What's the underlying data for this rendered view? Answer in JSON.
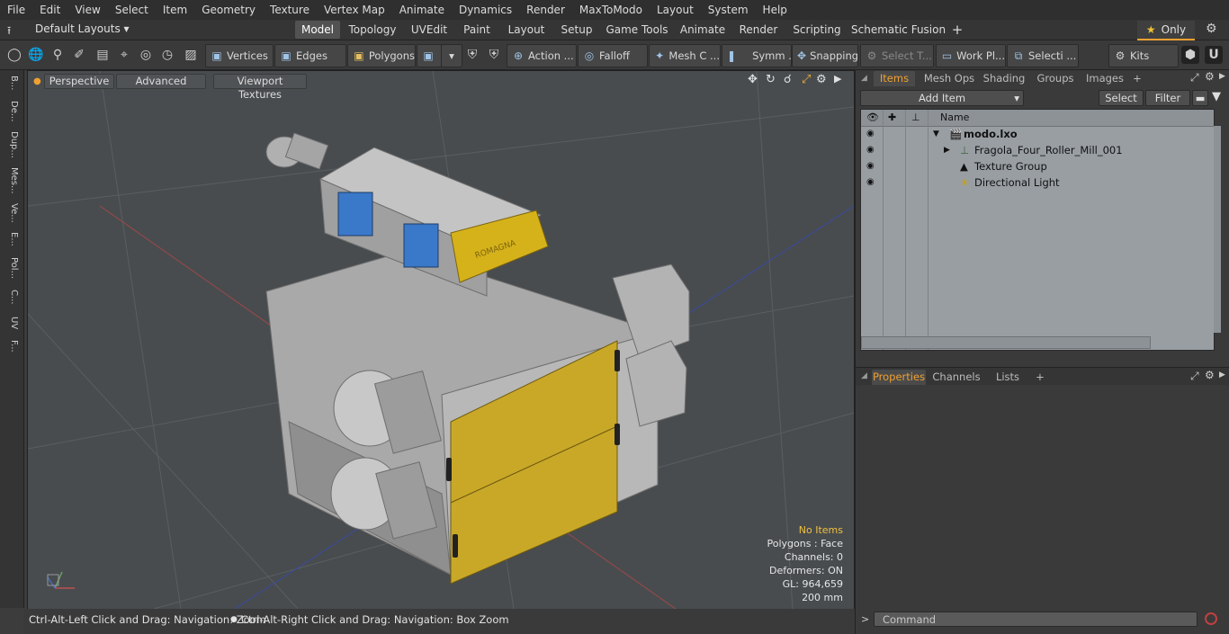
{
  "menu": [
    "File",
    "Edit",
    "View",
    "Select",
    "Item",
    "Geometry",
    "Texture",
    "Vertex Map",
    "Animate",
    "Dynamics",
    "Render",
    "MaxToModo",
    "Layout",
    "System",
    "Help"
  ],
  "layouts": {
    "label": "Default Layouts ▾",
    "only_label": "Only"
  },
  "tabs": [
    "Model",
    "Topology",
    "UVEdit",
    "Paint",
    "Layout",
    "Setup",
    "Game Tools",
    "Animate",
    "Render",
    "Scripting",
    "Schematic Fusion"
  ],
  "toolbar": {
    "vertices": "Vertices",
    "edges": "Edges",
    "polygons": "Polygons",
    "action": "Action ...",
    "falloff": "Falloff",
    "mesh": "Mesh C ...",
    "symm": "Symm ...",
    "snapping": "Snapping",
    "select_t": "Select T...",
    "work_pl": "Work Pl...",
    "selecti": "Selecti ...",
    "kits": "Kits"
  },
  "leftstrip": [
    "B...",
    "De...",
    "Dup...",
    "Mes...",
    "Ve...",
    "E...",
    "Pol...",
    "C...",
    "UV",
    "F..."
  ],
  "viewport": {
    "perspective": "Perspective",
    "advanced": "Advanced",
    "viewport_textures": "Viewport Textures",
    "stats": {
      "no_items": "No Items",
      "polygons": "Polygons : Face",
      "channels": "Channels: 0",
      "deformers": "Deformers: ON",
      "gl": "GL: 964,659",
      "scale": "200 mm"
    },
    "machine_label": "ROMAGNA"
  },
  "statusbar": {
    "hint1": "Ctrl-Alt-Left Click and Drag: Navigation: Zoom",
    "hint2": "Ctrl-Alt-Right Click and Drag: Navigation: Box Zoom"
  },
  "items_panel": {
    "tabs": [
      "Items",
      "Mesh Ops",
      "Shading",
      "Groups",
      "Images"
    ],
    "add_item": "Add Item",
    "select": "Select",
    "filter": "Filter",
    "col_name": "Name",
    "rows": [
      {
        "name": "modo.lxo"
      },
      {
        "name": "Fragola_Four_Roller_Mill_001"
      },
      {
        "name": "Texture Group"
      },
      {
        "name": "Directional Light"
      }
    ]
  },
  "props_panel": {
    "tabs": [
      "Properties",
      "Channels",
      "Lists"
    ]
  },
  "command": {
    "placeholder": "Command"
  },
  "colors": {
    "accent": "#f0a030",
    "list_bg": "#999ea3",
    "viewport_bg": "#484c4f",
    "machine_gray": "#b5b5b5",
    "machine_yellow": "#c9a828"
  }
}
